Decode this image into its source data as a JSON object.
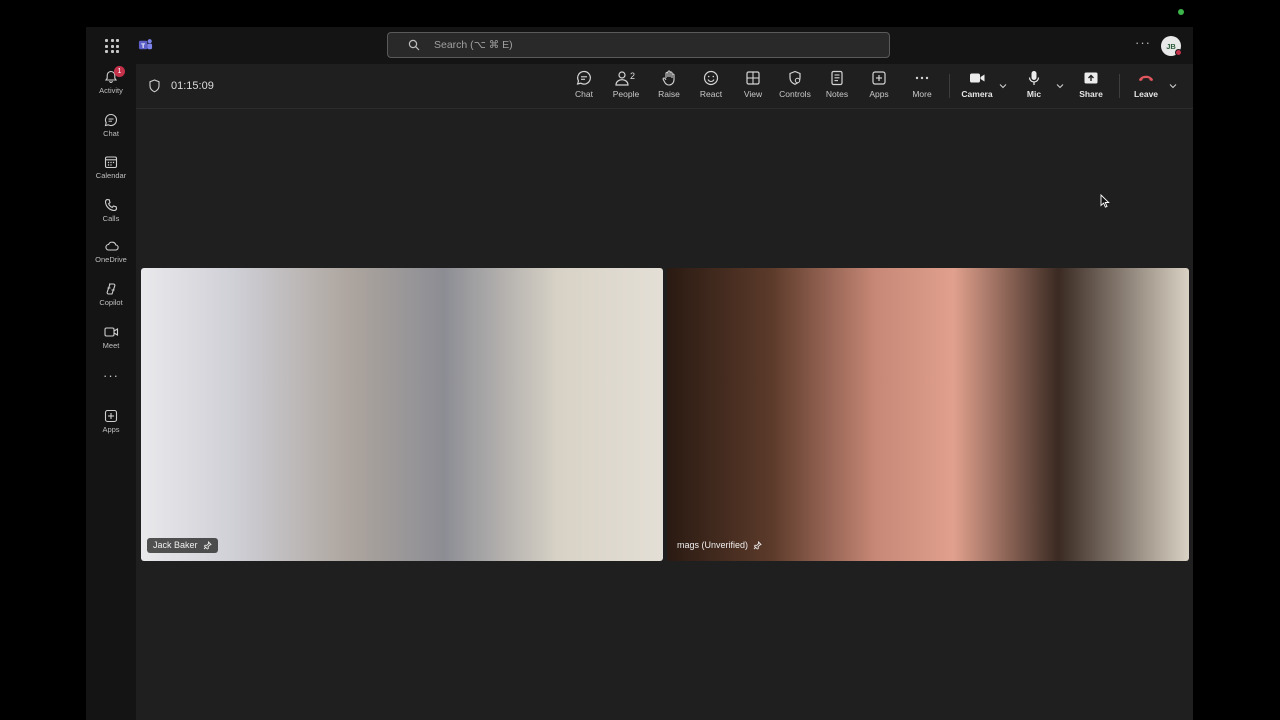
{
  "titlebar": {
    "search_placeholder": "Search (⌥ ⌘ E)",
    "more_label": "···",
    "avatar_initials": "JB"
  },
  "rail": {
    "items": [
      {
        "label": "Activity",
        "icon": "bell-icon",
        "badge": "1"
      },
      {
        "label": "Chat",
        "icon": "chat-icon"
      },
      {
        "label": "Calendar",
        "icon": "calendar-icon"
      },
      {
        "label": "Calls",
        "icon": "phone-icon"
      },
      {
        "label": "OneDrive",
        "icon": "cloud-icon"
      },
      {
        "label": "Copilot",
        "icon": "copilot-icon"
      },
      {
        "label": "Meet",
        "icon": "video-icon"
      },
      {
        "label": "Apps",
        "icon": "add-app-icon"
      }
    ],
    "more_label": "···"
  },
  "meeting": {
    "timer": "01:15:09",
    "toolbar": {
      "chat": "Chat",
      "people": "People",
      "people_count": "2",
      "raise": "Raise",
      "react": "React",
      "view": "View",
      "controls": "Controls",
      "notes": "Notes",
      "apps": "Apps",
      "more": "More",
      "camera": "Camera",
      "mic": "Mic",
      "share": "Share",
      "leave": "Leave"
    }
  },
  "participants": [
    {
      "name": "Jack Baker"
    },
    {
      "name": "mags (Unverified)"
    }
  ],
  "colors": {
    "background": "#1f1f1f",
    "rail": "#141414",
    "leave_red": "#e0575e",
    "badge_red": "#c4314b",
    "status_green": "#3bb54a"
  }
}
